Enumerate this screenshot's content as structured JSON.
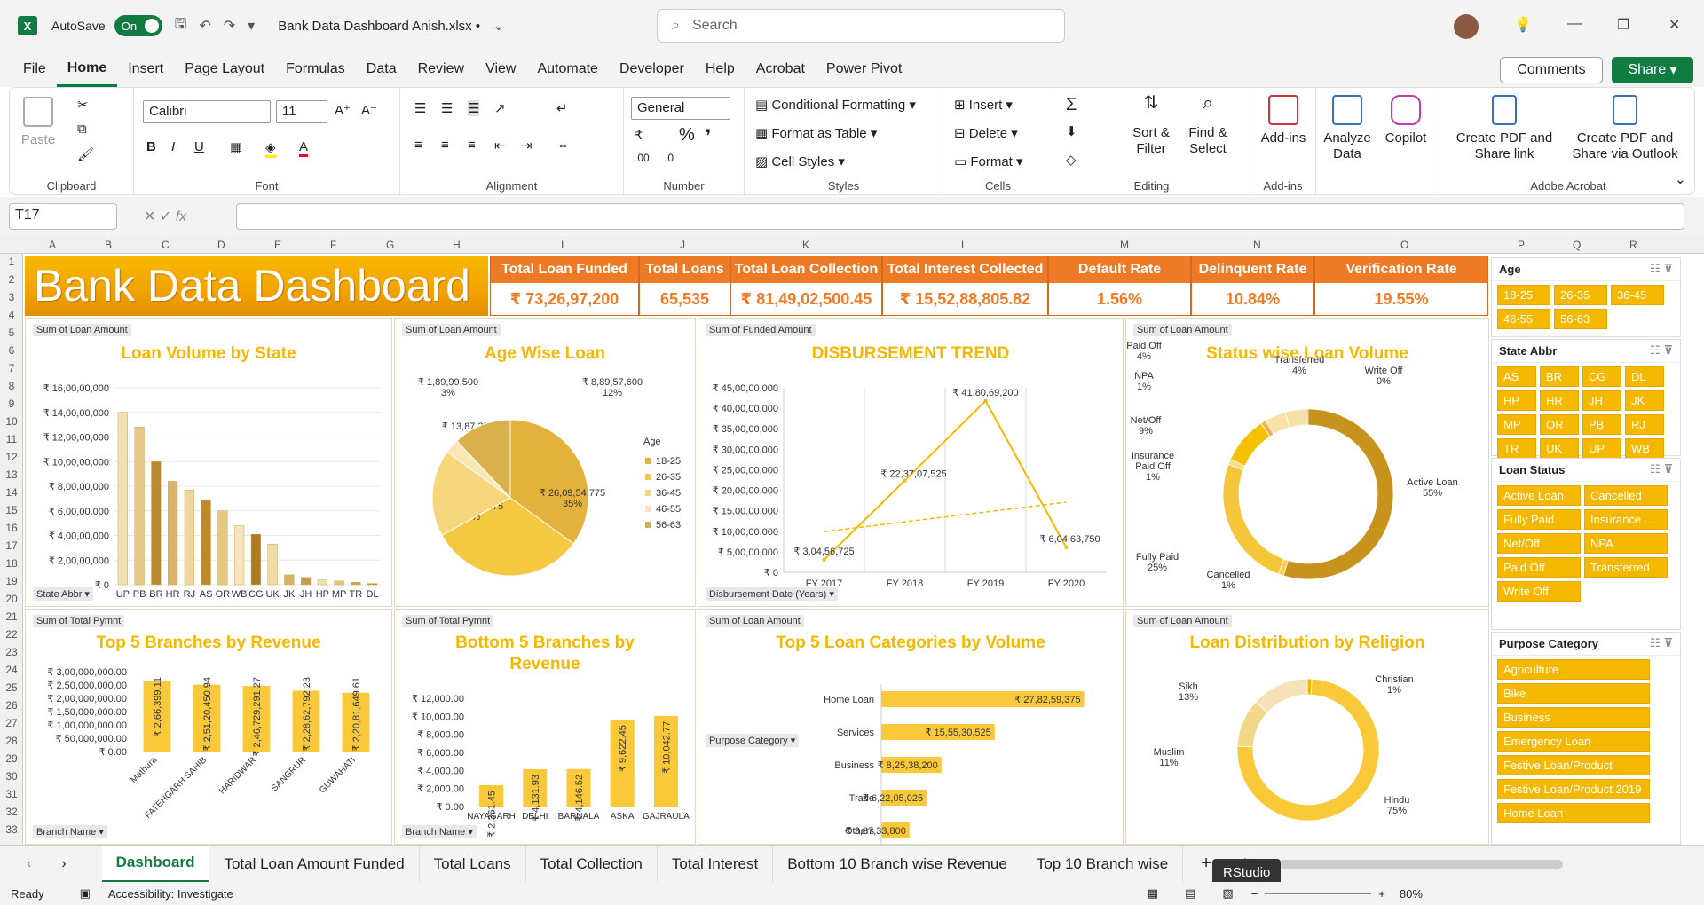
{
  "titlebar": {
    "autosave_label": "AutoSave",
    "autosave_state": "On",
    "file_name": "Bank Data Dashboard Anish.xlsx •",
    "search_placeholder": "Search"
  },
  "menu": [
    "File",
    "Home",
    "Insert",
    "Page Layout",
    "Formulas",
    "Data",
    "Review",
    "View",
    "Automate",
    "Developer",
    "Help",
    "Acrobat",
    "Power Pivot"
  ],
  "comments_label": "Comments",
  "share_label": "Share",
  "ribbon": {
    "paste": "Paste",
    "clipboard": "Clipboard",
    "font_name": "Calibri",
    "font_size": "11",
    "font": "Font",
    "alignment": "Alignment",
    "number_format": "General",
    "number": "Number",
    "cond_format": "Conditional Formatting",
    "format_table": "Format as Table",
    "cell_styles": "Cell Styles",
    "styles": "Styles",
    "insert": "Insert",
    "delete": "Delete",
    "format": "Format",
    "cells": "Cells",
    "sort_filter": "Sort & Filter",
    "find_select": "Find & Select",
    "editing": "Editing",
    "addins": "Add-ins",
    "addins_group": "Add-ins",
    "analyze_data": "Analyze Data",
    "copilot": "Copilot",
    "create_pdf_link": "Create PDF and Share link",
    "create_pdf_outlook": "Create PDF and Share via Outlook",
    "adobe_acrobat": "Adobe Acrobat"
  },
  "namebox": "T17",
  "columns": [
    "A",
    "B",
    "C",
    "D",
    "E",
    "F",
    "G",
    "H",
    "I",
    "J",
    "K",
    "L",
    "M",
    "N",
    "O",
    "P",
    "Q",
    "R"
  ],
  "rows": [
    "1",
    "2",
    "3",
    "4",
    "5",
    "6",
    "7",
    "8",
    "9",
    "10",
    "11",
    "12",
    "13",
    "14",
    "15",
    "16",
    "17",
    "18",
    "19",
    "20",
    "21",
    "22",
    "23",
    "24",
    "25",
    "26",
    "27",
    "28",
    "29",
    "30",
    "31",
    "32",
    "33"
  ],
  "banner_title": "Bank Data Dashboard",
  "kpis": [
    {
      "label": "Total Loan Funded",
      "value": "₹ 73,26,97,200"
    },
    {
      "label": "Total Loans",
      "value": "65,535"
    },
    {
      "label": "Total Loan Collection",
      "value": "₹ 81,49,02,500.45"
    },
    {
      "label": "Total Interest Collected",
      "value": "₹ 15,52,88,805.82"
    },
    {
      "label": "Default Rate",
      "value": "1.56%"
    },
    {
      "label": "Delinquent Rate",
      "value": "10.84%"
    },
    {
      "label": "Verification Rate",
      "value": "19.55%"
    }
  ],
  "panels": {
    "state": {
      "tag": "Sum of Loan Amount",
      "title": "Loan Volume by State",
      "filter": "State Abbr"
    },
    "age": {
      "tag": "Sum of Loan Amount",
      "title": "Age Wise Loan",
      "legend_title": "Age"
    },
    "disb": {
      "tag": "Sum of Funded Amount",
      "title": "DISBURSEMENT TREND",
      "filter": "Disbursement Date (Years)"
    },
    "status": {
      "tag": "Sum of Loan Amount",
      "title": "Status wise Loan Volume"
    },
    "top5": {
      "tag": "Sum of Total Pymnt",
      "title": "Top 5 Branches by Revenue",
      "filter": "Branch Name"
    },
    "bottom5": {
      "tag": "Sum of Total Pymnt",
      "title": "Bottom 5 Branches by Revenue",
      "filter": "Branch Name"
    },
    "cats": {
      "tag": "Sum of Loan Amount",
      "title": "Top 5 Loan Categories by Volume",
      "filter": "Purpose Category"
    },
    "religion": {
      "tag": "Sum of Loan Amount",
      "title": "Loan Distribution by Religion"
    }
  },
  "chart_data": [
    {
      "id": "state",
      "type": "bar",
      "categories": [
        "UP",
        "PB",
        "BR",
        "HR",
        "RJ",
        "AS",
        "OR",
        "WB",
        "CG",
        "UK",
        "JK",
        "JH",
        "HP",
        "MP",
        "TR",
        "DL"
      ],
      "values": [
        14000000,
        12800000,
        10000000,
        8400000,
        7700000,
        6900000,
        6000000,
        4800000,
        4100000,
        3300000,
        800000,
        600000,
        400000,
        300000,
        200000,
        100000
      ],
      "yticks": [
        "₹ 0",
        "₹ 2,00,00,000",
        "₹ 4,00,00,000",
        "₹ 6,00,00,000",
        "₹ 8,00,00,000",
        "₹ 10,00,00,000",
        "₹ 12,00,00,000",
        "₹ 14,00,00,000",
        "₹ 16,00,00,000"
      ],
      "ylim": [
        0,
        16000000
      ]
    },
    {
      "id": "age",
      "type": "pie",
      "categories": [
        "18-25",
        "26-35",
        "36-45",
        "46-55",
        "56-63"
      ],
      "values": [
        35,
        32,
        18,
        3,
        12
      ],
      "labels": [
        "₹ 26,09,54,775\n35%",
        "₹ 24,33,21,675\n32%",
        "₹ 13,87,33,950\n18%",
        "₹ 1,89,99,500\n3%",
        "₹ 8,89,57,600\n12%"
      ],
      "colors": [
        "#e3b23c",
        "#f5c842",
        "#f7d77e",
        "#fae6b4",
        "#d9b04a"
      ]
    },
    {
      "id": "disb",
      "type": "line",
      "categories": [
        "FY 2017",
        "FY 2018",
        "FY 2019",
        "FY 2020"
      ],
      "values": [
        30456725,
        223707525,
        418069200,
        60463750
      ],
      "labels": [
        "₹ 3,04,56,725",
        "₹ 22,37,07,525",
        "₹ 41,80,69,200",
        "₹ 6,04,63,750"
      ],
      "yticks": [
        "₹ 0",
        "₹ 5,00,00,000",
        "₹ 10,00,00,000",
        "₹ 15,00,00,000",
        "₹ 20,00,00,000",
        "₹ 25,00,00,000",
        "₹ 30,00,00,000",
        "₹ 35,00,00,000",
        "₹ 40,00,00,000",
        "₹ 45,00,00,000"
      ],
      "ylim": [
        0,
        450000000
      ]
    },
    {
      "id": "status",
      "type": "pie",
      "categories": [
        "Active Loan",
        "Cancelled",
        "Fully Paid",
        "Insurance Paid Off",
        "Net/Off",
        "NPA",
        "Paid Off",
        "Transferred",
        "Write Off"
      ],
      "values": [
        55,
        1,
        25,
        1,
        9,
        1,
        4,
        4,
        0
      ],
      "labels": [
        "Active Loan\n55%",
        "Cancelled\n1%",
        "Fully Paid\n25%",
        "Insurance\nPaid Off\n1%",
        "Net/Off\n9%",
        "NPA\n1%",
        "Paid Off\n4%",
        "Transferred\n4%",
        "Write Off\n0%"
      ]
    },
    {
      "id": "top5",
      "type": "bar",
      "categories": [
        "Mathura",
        "FATEHGARH SAHIB",
        "HARIDWAR",
        "SANGRUR",
        "GUWAHATI"
      ],
      "values": [
        2663399.11,
        2512450.94,
        2467291.27,
        2286279.23,
        2208649.61
      ],
      "labels": [
        "₹ 2,66,399.11",
        "₹ 2,51,20,450.94",
        "₹ 2,46,729,291.27",
        "₹ 2,28,62,792.23",
        "₹ 2,20,81,649.61"
      ],
      "yticks": [
        "₹ 0.00",
        "₹ 50,000,000.00",
        "₹ 1,00,000,000.00",
        "₹ 1,50,000,000.00",
        "₹ 2,00,000,000.00",
        "₹ 2,50,000,000.00",
        "₹ 3,00,000,000.00"
      ],
      "ylim": [
        0,
        3000000
      ]
    },
    {
      "id": "bottom5",
      "type": "bar",
      "categories": [
        "NAYAGARH",
        "DELHI",
        "BARNALA",
        "ASKA",
        "GAJRAULA"
      ],
      "values": [
        2361.45,
        4131.93,
        4146.52,
        9622.45,
        10042.77
      ],
      "labels": [
        "₹ 2,361.45",
        "₹ 4,131.93",
        "₹ 4,146.52",
        "₹ 9,622.45",
        "₹ 10,042.77"
      ],
      "yticks": [
        "₹ 0.00",
        "₹ 2,000.00",
        "₹ 4,000.00",
        "₹ 6,000.00",
        "₹ 8,000.00",
        "₹ 10,000.00",
        "₹ 12,000.00"
      ],
      "ylim": [
        0,
        12000
      ]
    },
    {
      "id": "cats",
      "type": "bar",
      "categories": [
        "Home Loan",
        "Services",
        "Business",
        "Trade",
        "Others"
      ],
      "values": [
        278259375,
        155530525,
        82538200,
        62205025,
        38733800
      ],
      "labels": [
        "₹ 27,82,59,375",
        "₹ 15,55,30,525",
        "₹ 8,25,38,200",
        "₹ 6,22,05,025",
        "₹ 3,87,33,800"
      ]
    },
    {
      "id": "religion",
      "type": "pie",
      "categories": [
        "Hindu",
        "Muslim",
        "Sikh",
        "Christian"
      ],
      "values": [
        75,
        11,
        13,
        1
      ],
      "labels": [
        "Hindu\n75%",
        "Muslim\n11%",
        "Sikh\n13%",
        "Christian\n1%"
      ]
    }
  ],
  "slicers": [
    {
      "title": "Age",
      "items": [
        "18-25",
        "26-35",
        "36-45",
        "46-55",
        "56-63"
      ]
    },
    {
      "title": "State Abbr",
      "items": [
        "AS",
        "BR",
        "CG",
        "DL",
        "HP",
        "HR",
        "JH",
        "JK",
        "MP",
        "OR",
        "PB",
        "RJ",
        "TR",
        "UK",
        "UP",
        "WB"
      ]
    },
    {
      "title": "Loan Status",
      "items": [
        "Active Loan",
        "Cancelled",
        "Fully Paid",
        "Insurance ...",
        "Net/Off",
        "NPA",
        "Paid Off",
        "Transferred",
        "Write Off"
      ]
    },
    {
      "title": "Purpose Category",
      "items": [
        "Agriculture",
        "Bike",
        "Business",
        "Emergency Loan",
        "Festive Loan/Product",
        "Festive Loan/Product 2019",
        "Home Loan"
      ]
    }
  ],
  "sheet_tabs": [
    "Dashboard",
    "Total Loan Amount Funded",
    "Total Loans",
    "Total Collection",
    "Total Interest",
    "Bottom 10 Branch wise Revenue",
    "Top 10 Branch wise"
  ],
  "tooltip": "RStudio",
  "status": {
    "ready": "Ready",
    "accessibility": "Accessibility: Investigate",
    "zoom": "80%"
  }
}
